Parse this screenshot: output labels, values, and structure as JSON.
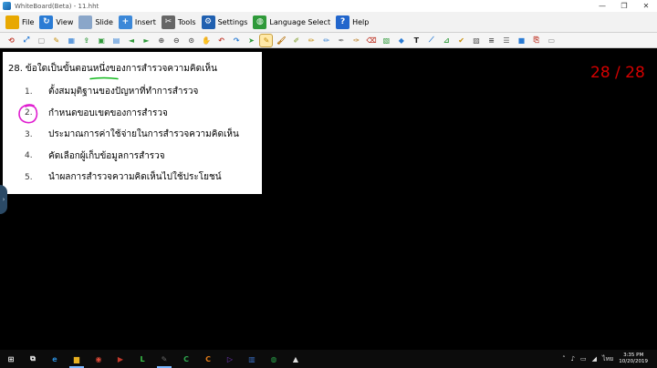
{
  "window": {
    "title": "WhiteBoard(Beta) - 11.hht",
    "controls": [
      "—",
      "❐",
      "✕"
    ]
  },
  "menu": [
    {
      "label": "File",
      "icon": "folder-icon",
      "color": "#e8a800",
      "glyph": ""
    },
    {
      "label": "View",
      "icon": "refresh-icon",
      "color": "#2a7bd4",
      "glyph": "↻"
    },
    {
      "label": "Slide",
      "icon": "slide-icon",
      "color": "#8aa6c9",
      "glyph": ""
    },
    {
      "label": "Insert",
      "icon": "insert-icon",
      "color": "#3c88d8",
      "glyph": "+"
    },
    {
      "label": "Tools",
      "icon": "tools-icon",
      "color": "#666666",
      "glyph": "✂"
    },
    {
      "label": "Settings",
      "icon": "gear-icon",
      "color": "#2060b0",
      "glyph": "⚙"
    },
    {
      "label": "Language Select",
      "icon": "globe-icon",
      "color": "#2f9a3a",
      "glyph": "◍"
    },
    {
      "label": "Help",
      "icon": "help-icon",
      "color": "#2266cc",
      "glyph": "?"
    }
  ],
  "toolbar": [
    {
      "name": "reload-icon",
      "color": "#c0392b",
      "glyph": "⟲"
    },
    {
      "name": "fullscreen-icon",
      "color": "#2a7bd4",
      "glyph": "⤢"
    },
    {
      "name": "blank-page-icon",
      "color": "#888888",
      "glyph": "▢"
    },
    {
      "name": "edit-page-icon",
      "color": "#c58a00",
      "glyph": "✎"
    },
    {
      "name": "grid-icon",
      "color": "#2a7bd4",
      "glyph": "▦"
    },
    {
      "name": "export-icon",
      "color": "#2f9a3a",
      "glyph": "⇪"
    },
    {
      "name": "save-icon",
      "color": "#2f9a3a",
      "glyph": "▣"
    },
    {
      "name": "book-icon",
      "color": "#2a7bd4",
      "glyph": "▤"
    },
    {
      "name": "arrow-left-icon",
      "color": "#2f9a3a",
      "glyph": "◄"
    },
    {
      "name": "arrow-right-icon",
      "color": "#2f9a3a",
      "glyph": "►"
    },
    {
      "name": "zoom-in-icon",
      "color": "#555555",
      "glyph": "⊕"
    },
    {
      "name": "zoom-out-icon",
      "color": "#555555",
      "glyph": "⊖"
    },
    {
      "name": "zoom-fit-icon",
      "color": "#555555",
      "glyph": "⊙"
    },
    {
      "name": "hand-icon",
      "color": "#c58a00",
      "glyph": "✋"
    },
    {
      "name": "undo-icon",
      "color": "#c0392b",
      "glyph": "↶"
    },
    {
      "name": "redo-icon",
      "color": "#2a7bd4",
      "glyph": "↷"
    },
    {
      "name": "cursor-icon",
      "color": "#2f9a3a",
      "glyph": "➤"
    },
    {
      "name": "pen-icon",
      "color": "#c58a00",
      "glyph": "✎",
      "active": true
    },
    {
      "name": "brush-icon",
      "color": "#b36b00",
      "glyph": "🖌"
    },
    {
      "name": "highlighter-icon",
      "color": "#7a9a20",
      "glyph": "✐"
    },
    {
      "name": "marker-icon",
      "color": "#c58a00",
      "glyph": "✏"
    },
    {
      "name": "pencil-icon",
      "color": "#2a7bd4",
      "glyph": "✏"
    },
    {
      "name": "chalk-icon",
      "color": "#888888",
      "glyph": "✒"
    },
    {
      "name": "calligraphy-icon",
      "color": "#b36b00",
      "glyph": "✑"
    },
    {
      "name": "eraser-icon",
      "color": "#c0392b",
      "glyph": "⌫"
    },
    {
      "name": "image-icon",
      "color": "#2f9a3a",
      "glyph": "▧"
    },
    {
      "name": "shapes-icon",
      "color": "#2a7bd4",
      "glyph": "◆"
    },
    {
      "name": "text-icon",
      "color": "#222222",
      "glyph": "T"
    },
    {
      "name": "line-icon",
      "color": "#2a7bd4",
      "glyph": "⟋"
    },
    {
      "name": "ruler-icon",
      "color": "#2f9a3a",
      "glyph": "⊿"
    },
    {
      "name": "check-icon",
      "color": "#c58a00",
      "glyph": "✔"
    },
    {
      "name": "pattern-icon",
      "color": "#555555",
      "glyph": "▨"
    },
    {
      "name": "stripes-icon",
      "color": "#555555",
      "glyph": "≡"
    },
    {
      "name": "lines-icon",
      "color": "#555555",
      "glyph": "☰"
    },
    {
      "name": "video-icon",
      "color": "#2a7bd4",
      "glyph": "■"
    },
    {
      "name": "screenshot-icon",
      "color": "#c0392b",
      "glyph": "⎘"
    },
    {
      "name": "extra-icon",
      "color": "#888888",
      "glyph": "▭"
    }
  ],
  "question": {
    "number": "28.",
    "text": "ข้อใดเป็นขั้นตอนหนึ่งของการสำรวจความคิดเห็น",
    "underline_color": "#11b81c",
    "options": [
      {
        "num": "1.",
        "text": "ตั้งสมมุติฐานของปัญหาที่ทำการสำรวจ"
      },
      {
        "num": "2.",
        "text": "กำหนดขอบเขตของการสำรวจ"
      },
      {
        "num": "3.",
        "text": "ประมาณการค่าใช้จ่ายในการสำรวจความคิดเห็น"
      },
      {
        "num": "4.",
        "text": "คัดเลือกผู้เก็บข้อมูลการสำรวจ"
      },
      {
        "num": "5.",
        "text": "นำผลการสำรวจความคิดเห็นไปใช้ประโยชน์"
      }
    ],
    "circle_color": "#e01ed0"
  },
  "page_counter": "28 / 28",
  "taskbar": {
    "items": [
      {
        "name": "start-button",
        "glyph": "⊞",
        "color": "#ffffff",
        "open": false
      },
      {
        "name": "task-view-icon",
        "glyph": "⧉",
        "color": "#ffffff",
        "open": false
      },
      {
        "name": "edge-icon",
        "glyph": "e",
        "color": "#2b8bd6",
        "open": false
      },
      {
        "name": "file-explorer-icon",
        "glyph": "▆",
        "color": "#e8b020",
        "open": true
      },
      {
        "name": "chrome-icon",
        "glyph": "◉",
        "color": "#dd4a38",
        "open": false
      },
      {
        "name": "media-icon",
        "glyph": "▶",
        "color": "#c0392b",
        "open": false
      },
      {
        "name": "line-app-icon",
        "glyph": "L",
        "color": "#3ac34a",
        "open": false
      },
      {
        "name": "whiteboard-app-icon",
        "glyph": "✎",
        "color": "#6a6a6a",
        "open": true
      },
      {
        "name": "camtasia-icon",
        "glyph": "C",
        "color": "#2fa84f",
        "open": false
      },
      {
        "name": "camtasia-recorder-icon",
        "glyph": "C",
        "color": "#e07a18",
        "open": false
      },
      {
        "name": "video-player-icon",
        "glyph": "▷",
        "color": "#7a3ac8",
        "open": false
      },
      {
        "name": "paint-icon",
        "glyph": "▥",
        "color": "#3b6fc4",
        "open": false
      },
      {
        "name": "browser-icon",
        "glyph": "◍",
        "color": "#2aa34a",
        "open": false
      },
      {
        "name": "photos-icon",
        "glyph": "▲",
        "color": "#dddddd",
        "open": false
      }
    ],
    "tray_icons": [
      "˄",
      "♪",
      "▭",
      "◢",
      "ไทย"
    ],
    "time": "3:35 PM",
    "date": "10/20/2019"
  }
}
